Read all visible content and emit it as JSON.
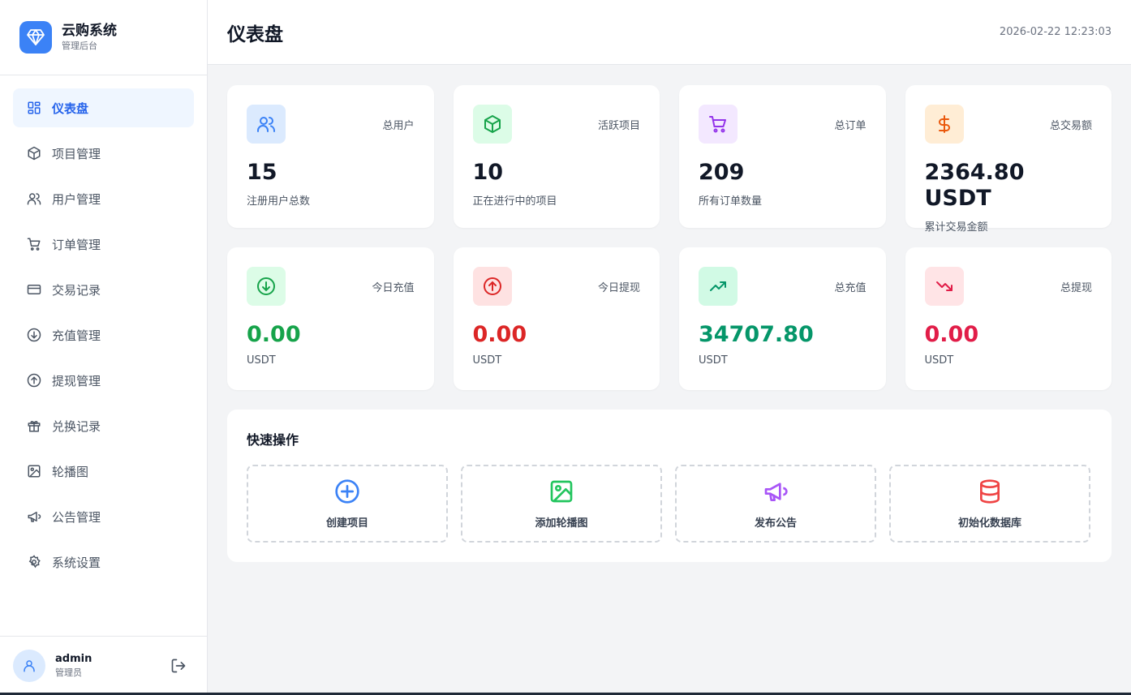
{
  "brand": {
    "title": "云购系统",
    "subtitle": "管理后台",
    "logo_icon": "diamond-icon",
    "color": "#3b82f6"
  },
  "sidebar": {
    "items": [
      {
        "label": "仪表盘",
        "icon": "grid-icon",
        "active": true
      },
      {
        "label": "项目管理",
        "icon": "box-icon"
      },
      {
        "label": "用户管理",
        "icon": "users-icon"
      },
      {
        "label": "订单管理",
        "icon": "cart-icon"
      },
      {
        "label": "交易记录",
        "icon": "card-icon"
      },
      {
        "label": "充值管理",
        "icon": "arrow-down-circle-icon"
      },
      {
        "label": "提现管理",
        "icon": "arrow-up-circle-icon"
      },
      {
        "label": "兑换记录",
        "icon": "gift-icon"
      },
      {
        "label": "轮播图",
        "icon": "image-icon"
      },
      {
        "label": "公告管理",
        "icon": "megaphone-icon"
      },
      {
        "label": "系统设置",
        "icon": "gear-icon"
      }
    ]
  },
  "user": {
    "name": "admin",
    "role": "管理员"
  },
  "header": {
    "title": "仪表盘",
    "datetime": "2026-02-22 12:23:03"
  },
  "stats": [
    {
      "label": "总用户",
      "value": "15",
      "desc": "注册用户总数",
      "icon": "users-icon",
      "icon_color": "#3b82f6",
      "bg": "#dbeafe",
      "value_color": "#111827"
    },
    {
      "label": "活跃项目",
      "value": "10",
      "desc": "正在进行中的项目",
      "icon": "box-icon",
      "icon_color": "#16a34a",
      "bg": "#dcfce7",
      "value_color": "#111827"
    },
    {
      "label": "总订单",
      "value": "209",
      "desc": "所有订单数量",
      "icon": "cart-icon",
      "icon_color": "#9333ea",
      "bg": "#f3e8ff",
      "value_color": "#111827"
    },
    {
      "label": "总交易额",
      "value": "2364.80 USDT",
      "desc": "累计交易金额",
      "icon": "dollar-icon",
      "icon_color": "#ea580c",
      "bg": "#ffedd5",
      "value_color": "#111827"
    },
    {
      "label": "今日充值",
      "value": "0.00",
      "desc": "USDT",
      "icon": "arrow-down-circle-icon",
      "icon_color": "#16a34a",
      "bg": "#dcfce7",
      "value_color": "#16a34a"
    },
    {
      "label": "今日提现",
      "value": "0.00",
      "desc": "USDT",
      "icon": "arrow-up-circle-icon",
      "icon_color": "#dc2626",
      "bg": "#fee2e2",
      "value_color": "#dc2626"
    },
    {
      "label": "总充值",
      "value": "34707.80",
      "desc": "USDT",
      "icon": "trending-up-icon",
      "icon_color": "#059669",
      "bg": "#d1fae5",
      "value_color": "#059669"
    },
    {
      "label": "总提现",
      "value": "0.00",
      "desc": "USDT",
      "icon": "trending-down-icon",
      "icon_color": "#e11d48",
      "bg": "#ffe4e6",
      "value_color": "#e11d48"
    }
  ],
  "quick": {
    "title": "快速操作",
    "actions": [
      {
        "label": "创建项目",
        "icon": "plus-circle-icon",
        "color": "#3b82f6"
      },
      {
        "label": "添加轮播图",
        "icon": "image-icon",
        "color": "#22c55e"
      },
      {
        "label": "发布公告",
        "icon": "megaphone-icon",
        "color": "#a855f7"
      },
      {
        "label": "初始化数据库",
        "icon": "database-icon",
        "color": "#ef4444"
      }
    ]
  }
}
